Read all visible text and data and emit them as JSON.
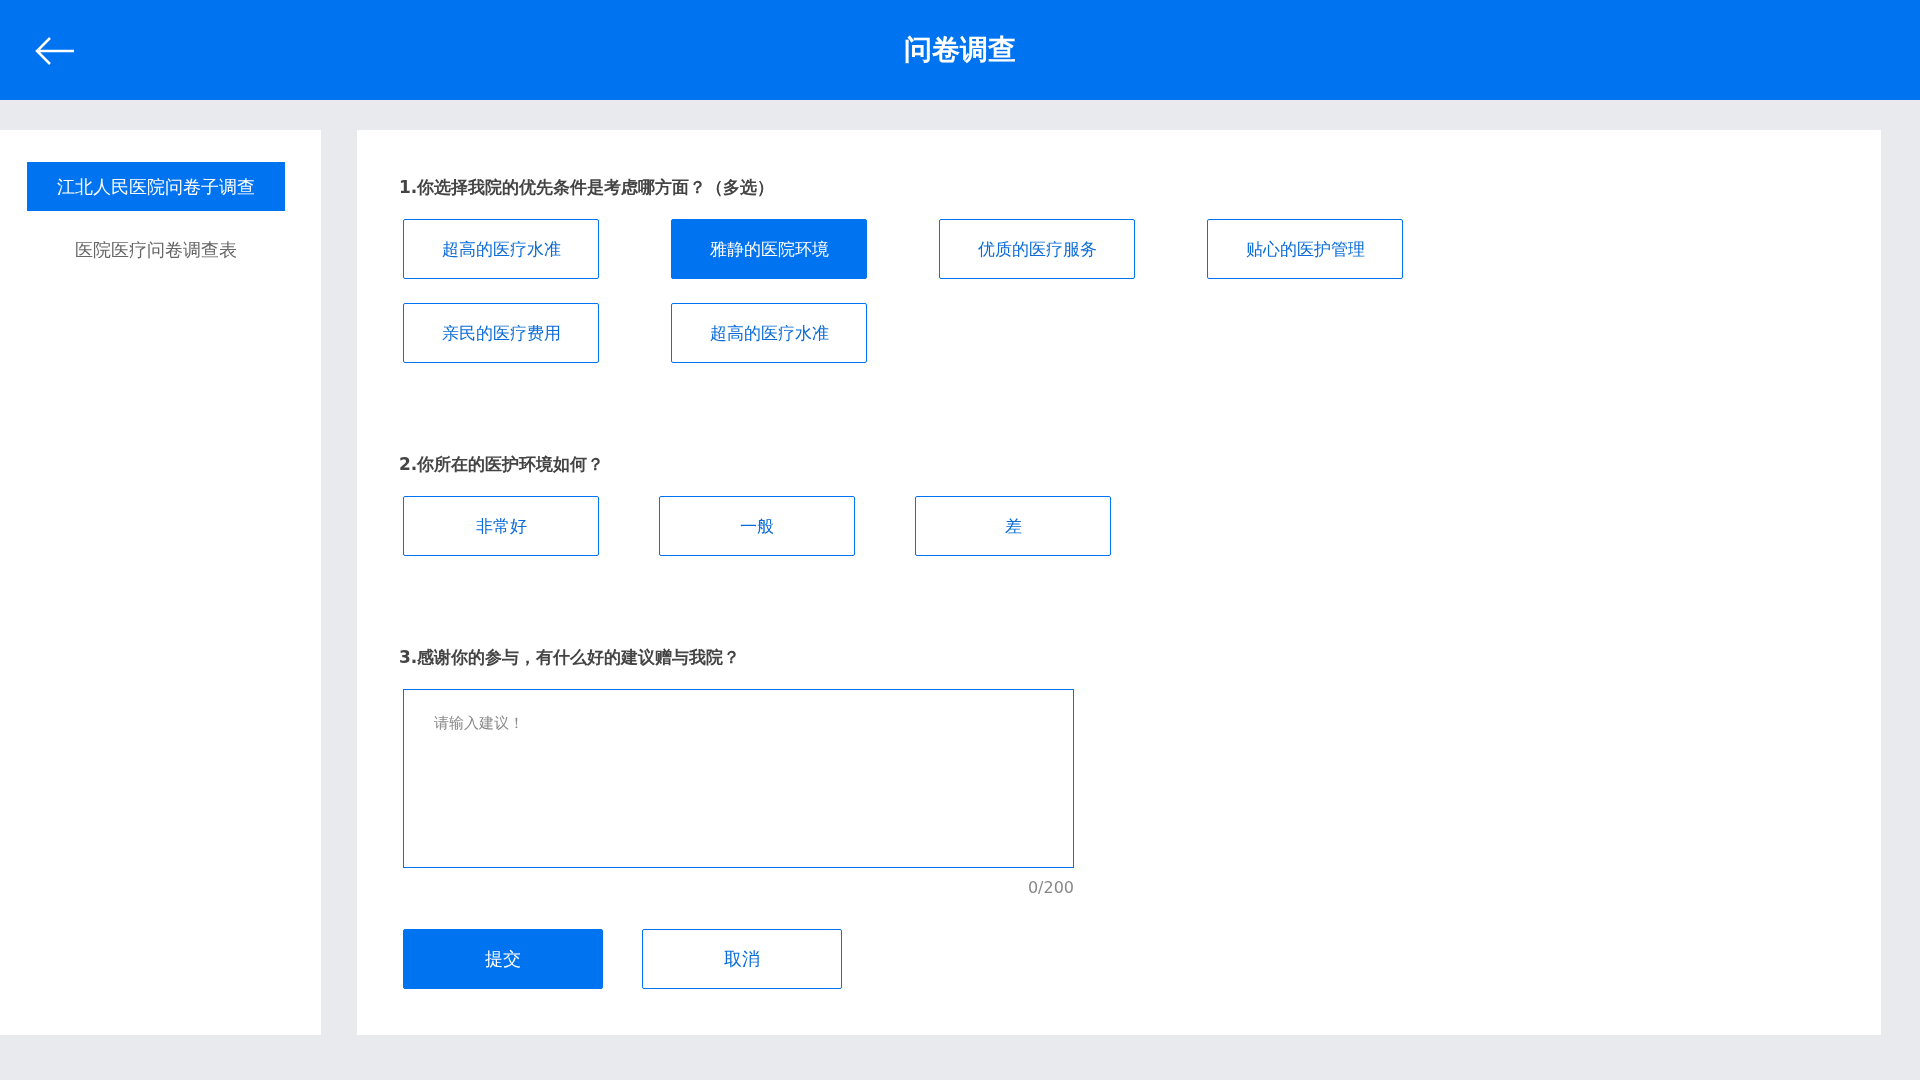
{
  "header": {
    "title": "问卷调查"
  },
  "sidebar": {
    "items": [
      {
        "label": "江北人民医院问卷子调查",
        "selected": true
      },
      {
        "label": "医院医疗问卷调查表",
        "selected": false
      }
    ]
  },
  "questions": [
    {
      "kind": "choice",
      "title": "1.你选择我院的优先条件是考虑哪方面？（多选）",
      "options": [
        {
          "label": "超高的医疗水准",
          "selected": false
        },
        {
          "label": "雅静的医院环境",
          "selected": true
        },
        {
          "label": "优质的医疗服务",
          "selected": false
        },
        {
          "label": "贴心的医护管理",
          "selected": false
        },
        {
          "label": "亲民的医疗费用",
          "selected": false
        },
        {
          "label": "超高的医疗水准",
          "selected": false
        }
      ]
    },
    {
      "kind": "choice",
      "title": "2.你所在的医护环境如何？",
      "options": [
        {
          "label": "非常好",
          "selected": false
        },
        {
          "label": "一般",
          "selected": false
        },
        {
          "label": "差",
          "selected": false
        }
      ]
    },
    {
      "kind": "text",
      "title": "3.感谢你的参与，有什么好的建议赠与我院？",
      "placeholder": "请输入建议！",
      "counter": "0/200"
    }
  ],
  "actions": [
    {
      "label": "提交",
      "kind": "primary"
    },
    {
      "label": "取消",
      "kind": "secondary"
    }
  ]
}
